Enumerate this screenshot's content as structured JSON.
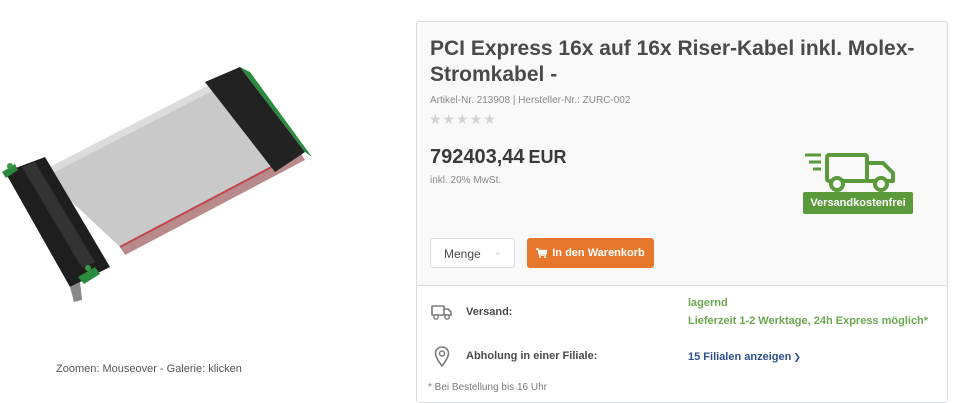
{
  "gallery": {
    "image_alt": "PCI Express Riser-Kabel",
    "zoom_hint": "Zoomen: Mouseover - Galerie: klicken"
  },
  "product": {
    "title": "PCI Express 16x auf 16x Riser-Kabel inkl. Molex-Stromkabel -",
    "meta": "Artikel-Nr. 213908 | Hersteller-Nr.: ZURC-002",
    "rating_stars": "★★★★★",
    "rating_value": 0,
    "price": "792403,44",
    "currency": "EUR",
    "tax_note": "inkl. 20% MwSt."
  },
  "badge": {
    "label": "Versandkostenfrei",
    "icon": "truck-icon",
    "color": "#5a9a3b"
  },
  "actions": {
    "quantity_label": "Menge",
    "cart_label": "In den Warenkorb",
    "cart_color": "#e8772e"
  },
  "delivery": {
    "shipping_label": "Versand:",
    "shipping_status": "lagernd",
    "shipping_time": "Lieferzeit 1-2 Werktage, 24h Express möglich*",
    "pickup_label": "Abholung in einer Filiale:",
    "stores_link": "15 Filialen anzeigen",
    "footnote": "* Bei Bestellung bis 16 Uhr"
  }
}
